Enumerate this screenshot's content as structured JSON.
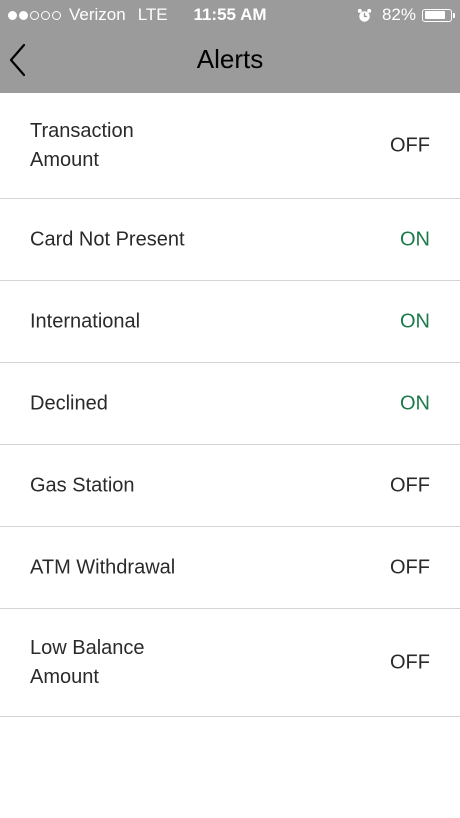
{
  "status_bar": {
    "carrier": "Verizon",
    "network": "LTE",
    "time": "11:55 AM",
    "battery_percent": "82%",
    "battery_level": 0.82,
    "signal_bars_filled": 2,
    "signal_bars_total": 5
  },
  "nav": {
    "title": "Alerts",
    "back_icon": "chevron-left-icon"
  },
  "colors": {
    "header_bg": "#9b9b9b",
    "on_color": "#1c7a4a",
    "off_color": "#2a2a2a",
    "divider": "#d4d4d4"
  },
  "alerts": [
    {
      "label": "Transaction Amount",
      "value": "OFF"
    },
    {
      "label": "Card Not Present",
      "value": "ON"
    },
    {
      "label": "International",
      "value": "ON"
    },
    {
      "label": "Declined",
      "value": "ON"
    },
    {
      "label": "Gas Station",
      "value": "OFF"
    },
    {
      "label": "ATM Withdrawal",
      "value": "OFF"
    },
    {
      "label": "Low Balance Amount",
      "value": "OFF"
    }
  ]
}
